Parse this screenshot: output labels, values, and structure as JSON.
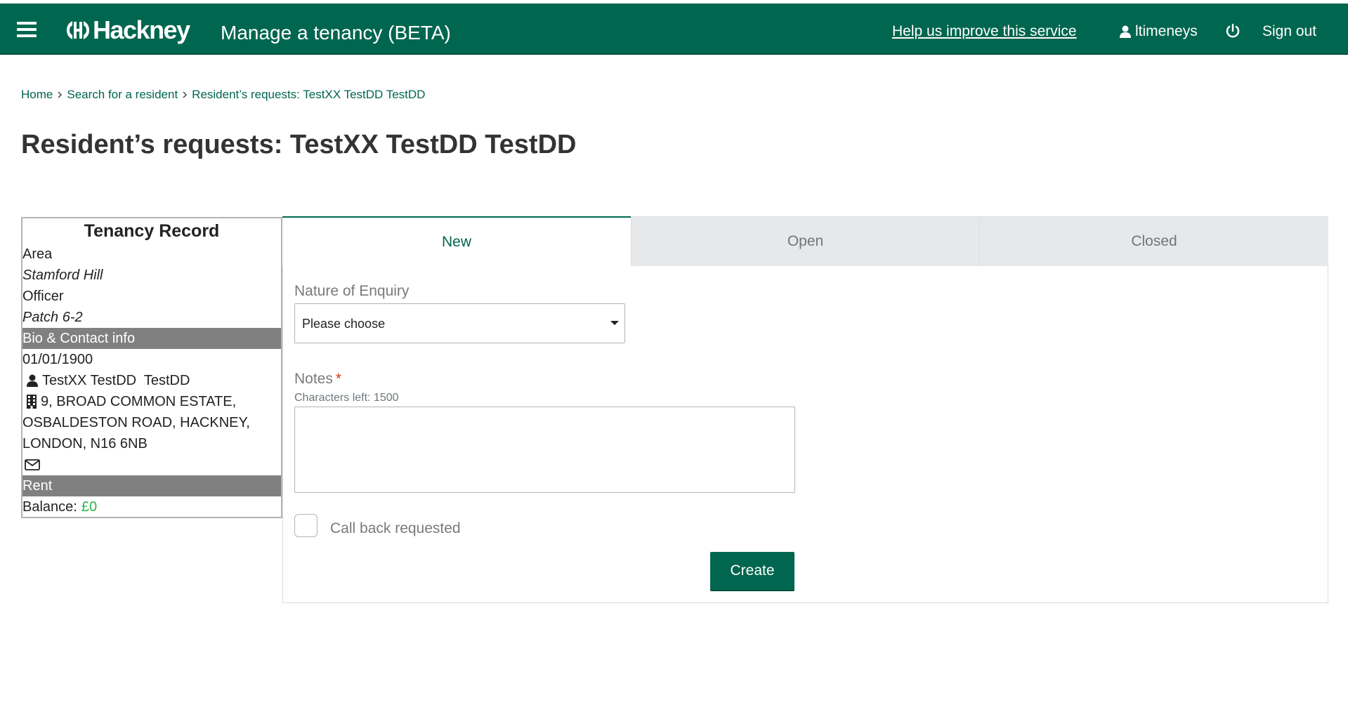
{
  "header": {
    "logo_text": "Hackney",
    "service_name": "Manage a tenancy (BETA)",
    "help_link": "Help us improve this service",
    "username": "ltimeneys",
    "sign_out": "Sign out",
    "background_color": "#00664f"
  },
  "breadcrumb": {
    "items": [
      "Home",
      "Search for a resident",
      "Resident’s requests: TestXX TestDD TestDD"
    ]
  },
  "page_title": "Resident’s requests: TestXX TestDD TestDD",
  "tenancy_record": {
    "title": "Tenancy Record",
    "area_label": "Area",
    "area_value": "Stamford Hill",
    "officer_label": "Officer",
    "officer_value": "Patch 6-2",
    "bio_section": "Bio & Contact info",
    "dob": "01/01/1900",
    "name": "TestXX TestDD  TestDD",
    "address_line1": "9, BROAD COMMON ESTATE,",
    "address_line2": "OSBALDESTON ROAD, HACKNEY,",
    "address_line3": "LONDON, N16 6NB",
    "rent_section": "Rent",
    "balance_label": "Balance:",
    "balance_value": "£0"
  },
  "tabs": [
    {
      "label": "New",
      "active": true
    },
    {
      "label": "Open",
      "active": false
    },
    {
      "label": "Closed",
      "active": false
    }
  ],
  "form": {
    "enquiry_label": "Nature of Enquiry",
    "enquiry_selected": "Please choose",
    "notes_label": "Notes",
    "notes_required_marker": "*",
    "chars_left": "Characters left: 1500",
    "notes_value": "",
    "callback_label": "Call back requested",
    "create_button": "Create"
  },
  "colors": {
    "brand_green": "#00664f",
    "section_grey": "#808080",
    "balance_green": "#2cb34a",
    "required_red": "#d4351c"
  }
}
